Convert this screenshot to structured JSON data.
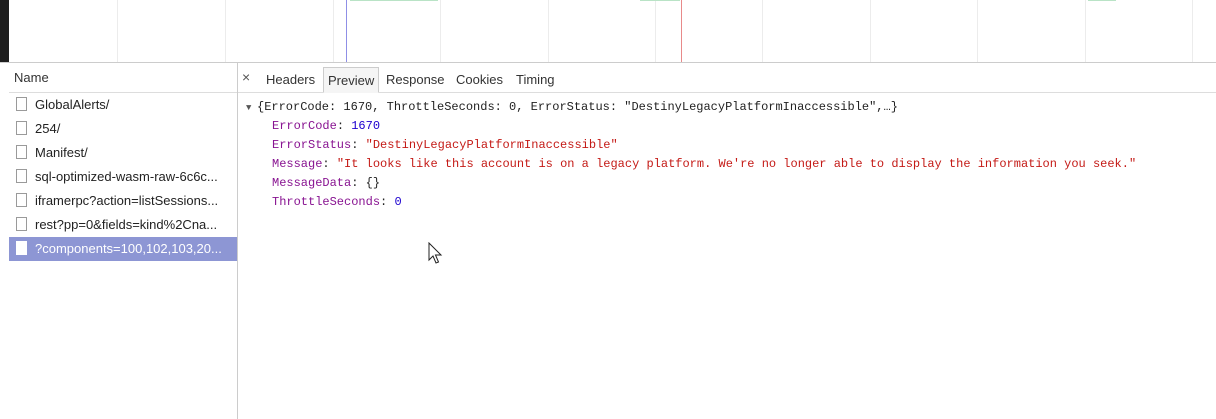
{
  "names_panel": {
    "header": "Name",
    "items": [
      {
        "label": "GlobalAlerts/",
        "selected": false
      },
      {
        "label": "254/",
        "selected": false
      },
      {
        "label": "Manifest/",
        "selected": false
      },
      {
        "label": "sql-optimized-wasm-raw-6c6c...",
        "selected": false
      },
      {
        "label": "iframerpc?action=listSessions...",
        "selected": false
      },
      {
        "label": "rest?pp=0&fields=kind%2Cna...",
        "selected": false
      },
      {
        "label": "?components=100,102,103,20...",
        "selected": true
      }
    ]
  },
  "tabs": {
    "close": "×",
    "headers": "Headers",
    "preview": "Preview",
    "response": "Response",
    "cookies": "Cookies",
    "timing": "Timing",
    "active": "Preview"
  },
  "preview": {
    "summary": "{ErrorCode: 1670, ThrottleSeconds: 0, ErrorStatus: \"DestinyLegacyPlatformInaccessible\",…}",
    "error_code": {
      "key": "ErrorCode",
      "value": "1670"
    },
    "error_status": {
      "key": "ErrorStatus",
      "value": "\"DestinyLegacyPlatformInaccessible\""
    },
    "message": {
      "key": "Message",
      "value": "\"It looks like this account is on a legacy platform. We're no longer able to display the information you seek.\""
    },
    "message_data": {
      "key": "MessageData",
      "value": "{}"
    },
    "throttle_seconds": {
      "key": "ThrottleSeconds",
      "value": "0"
    }
  },
  "colors": {
    "selection": "#8d96d4",
    "key": "#881391",
    "string": "#c41a16",
    "number": "#1c00cf",
    "timeline_blue_marker": "#8f8fe6",
    "timeline_red_marker": "#e88a8a"
  }
}
